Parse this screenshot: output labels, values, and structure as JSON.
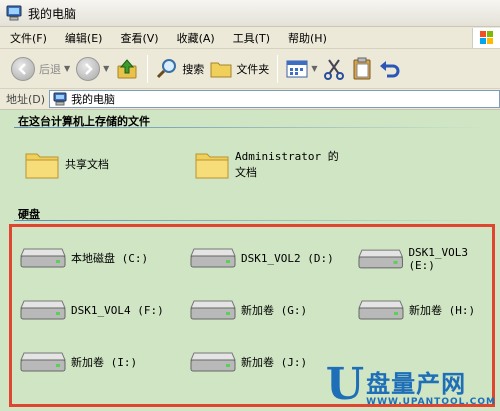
{
  "window": {
    "title": "我的电脑"
  },
  "menu": [
    "文件(F)",
    "编辑(E)",
    "查看(V)",
    "收藏(A)",
    "工具(T)",
    "帮助(H)"
  ],
  "toolbar": {
    "back": "后退",
    "search": "搜索",
    "folders": "文件夹"
  },
  "address": {
    "label": "地址(D)",
    "value": "我的电脑"
  },
  "sections": {
    "stored": {
      "title": "在这台计算机上存储的文件",
      "items": [
        "共享文档",
        "Administrator 的文档"
      ]
    },
    "drives": {
      "title": "硬盘",
      "items": [
        "本地磁盘 (C:)",
        "DSK1_VOL2 (D:)",
        "DSK1_VOL3 (E:)",
        "DSK1_VOL4 (F:)",
        "新加卷 (G:)",
        "新加卷 (H:)",
        "新加卷 (I:)",
        "新加卷 (J:)"
      ]
    }
  },
  "watermark": {
    "letter": "U",
    "text": "盘量产网",
    "url": "WWW.UPANTOOL.COM"
  },
  "colors": {
    "content_bg": "#cfe5c3",
    "highlight_border": "#e0462f",
    "watermark": "#1e6fb8"
  }
}
